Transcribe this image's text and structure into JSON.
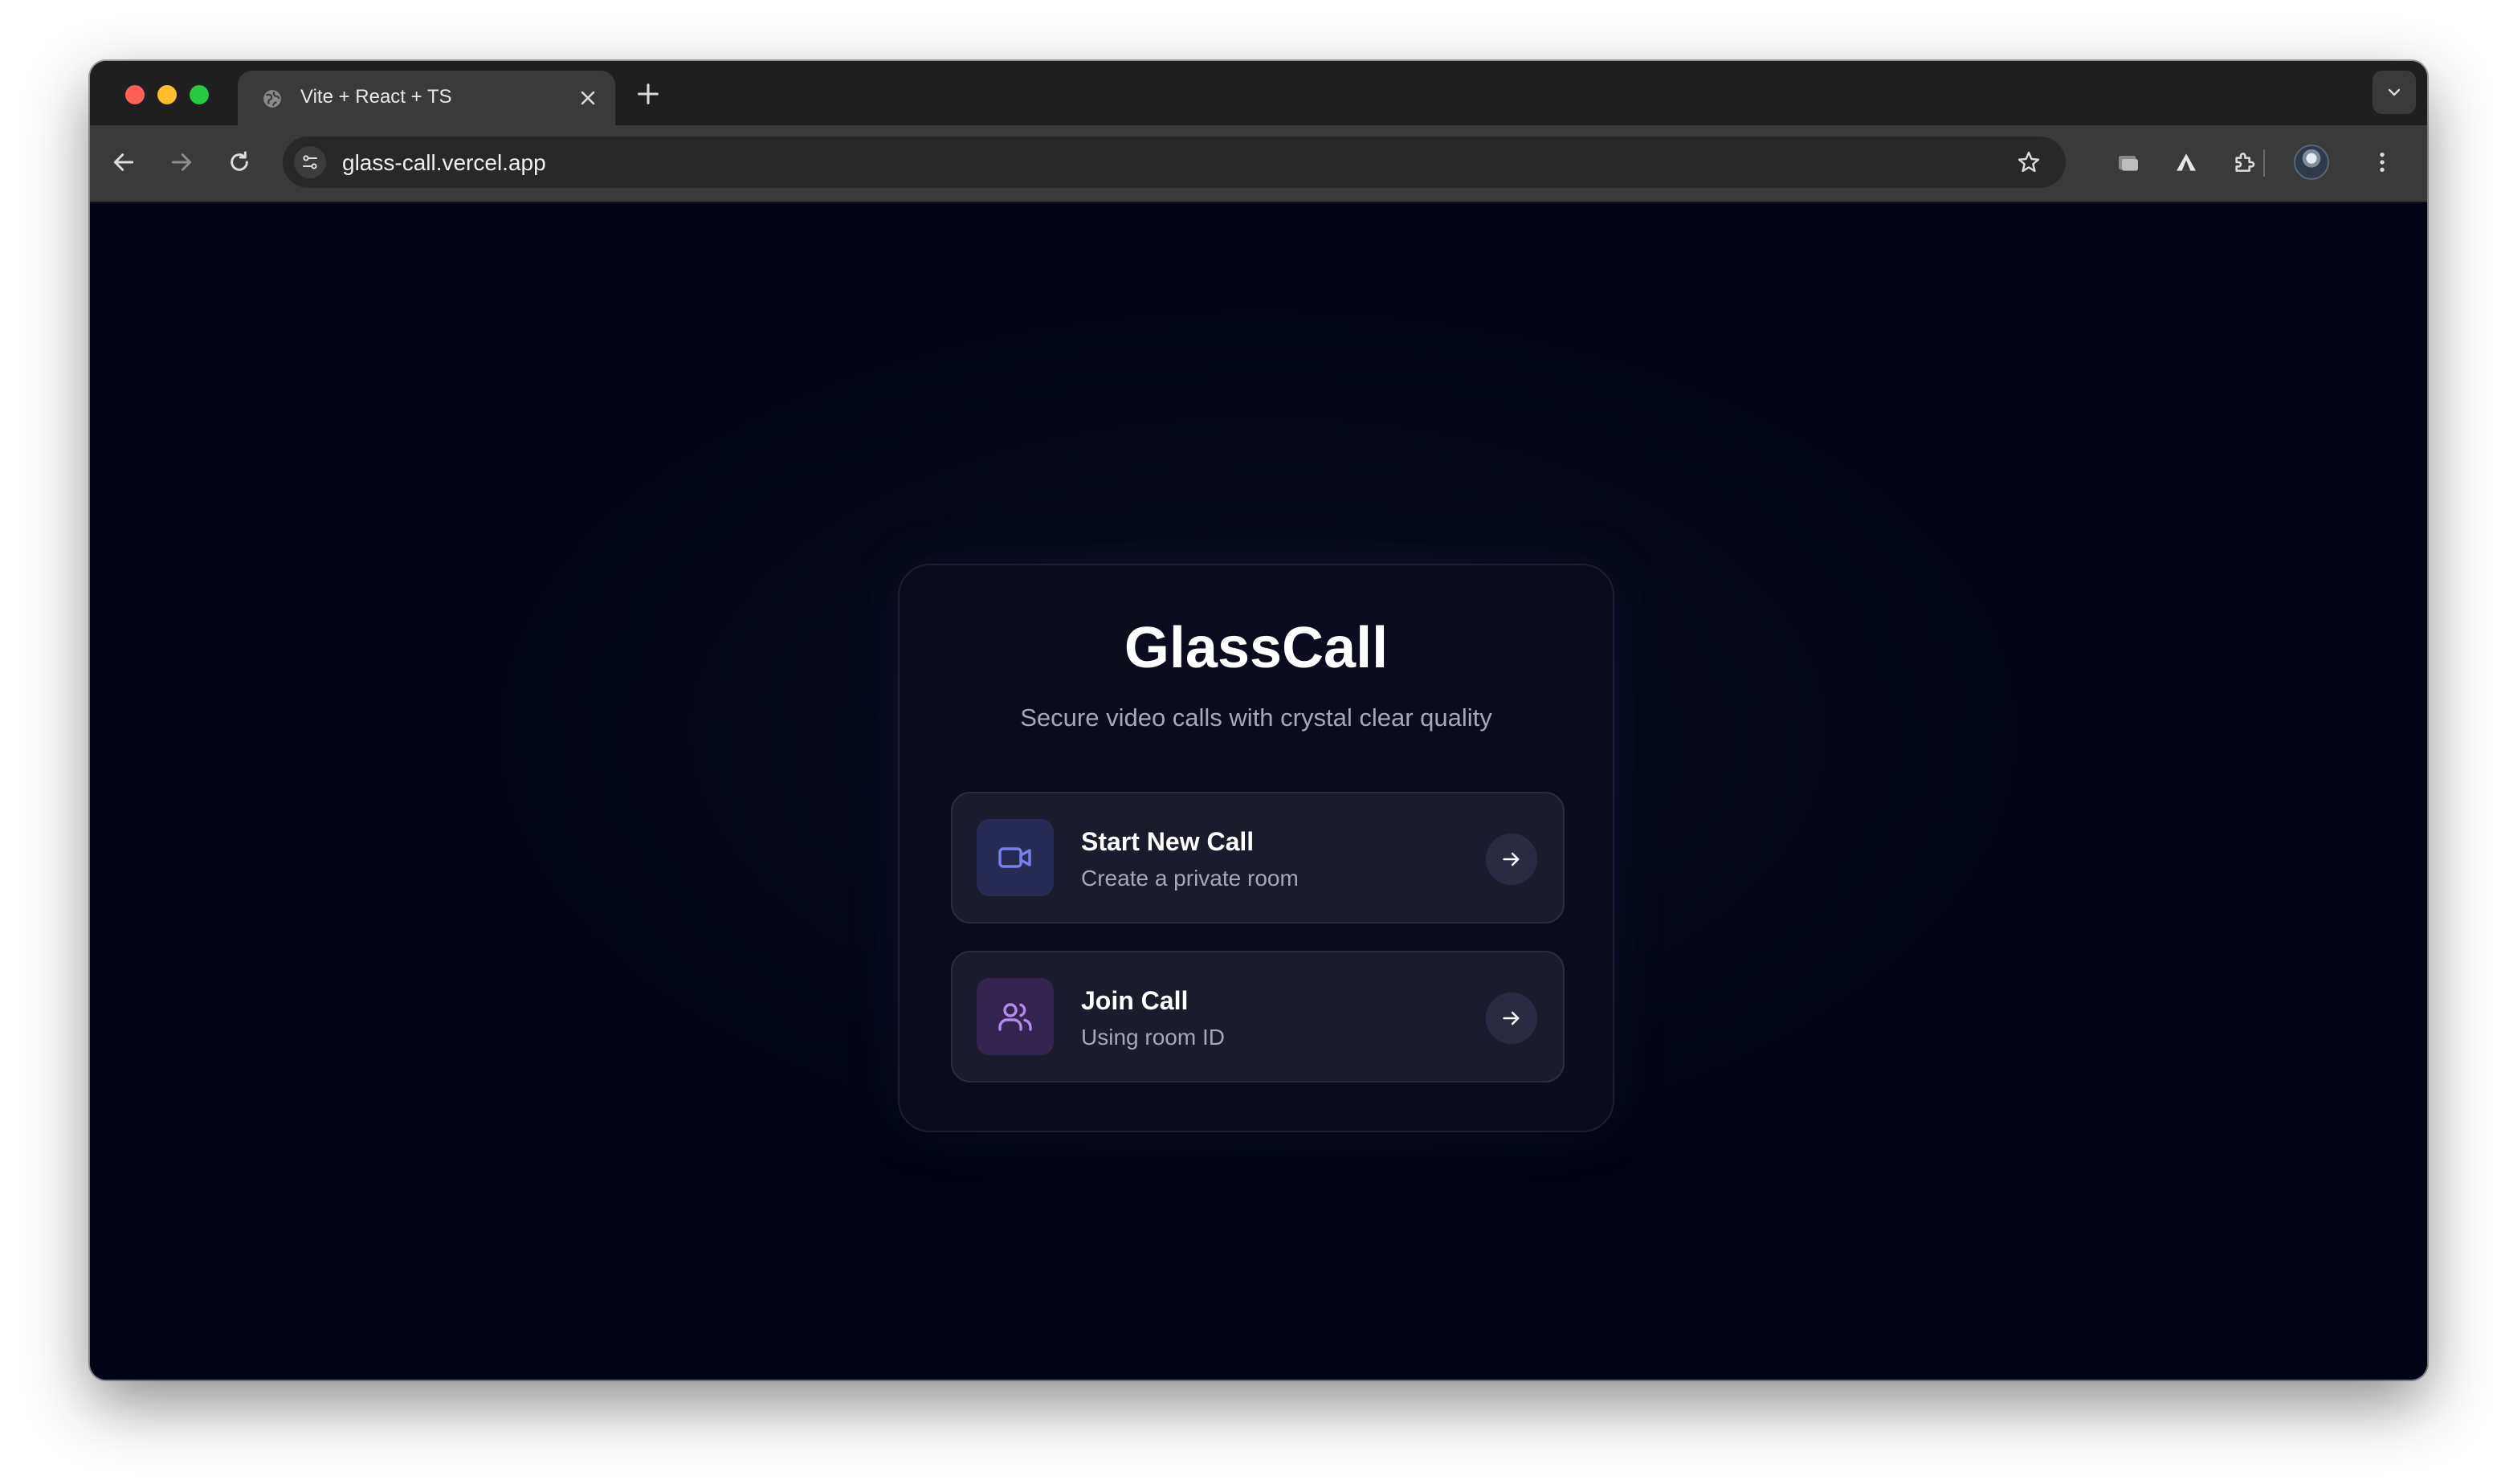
{
  "browser": {
    "tab_title": "Vite + React + TS",
    "url": "glass-call.vercel.app",
    "icons": {
      "favicon": "globe-icon",
      "close": "close-icon",
      "new_tab": "plus-icon",
      "tab_list": "chevron-down-icon",
      "back": "arrow-left-icon",
      "forward": "arrow-right-icon",
      "reload": "reload-icon",
      "site_settings": "tune-icon",
      "bookmark": "star-icon",
      "extension_1": "folder-icon",
      "extension_2": "triangle-icon",
      "extensions": "puzzle-icon",
      "profile": "avatar",
      "menu": "kebab-menu-icon"
    }
  },
  "app": {
    "title": "GlassCall",
    "subtitle": "Secure video calls with crystal clear quality",
    "options": [
      {
        "title": "Start New Call",
        "description": "Create a private room",
        "icon": "video-camera-icon",
        "action_icon": "arrow-right-icon"
      },
      {
        "title": "Join Call",
        "description": "Using room ID",
        "icon": "users-icon",
        "action_icon": "arrow-right-icon"
      }
    ]
  },
  "colors": {
    "page_background": "#000312",
    "card_background": "#0b0b1e",
    "video_icon_accent": "#7b7ef0",
    "users_icon_accent": "#b48be8"
  }
}
